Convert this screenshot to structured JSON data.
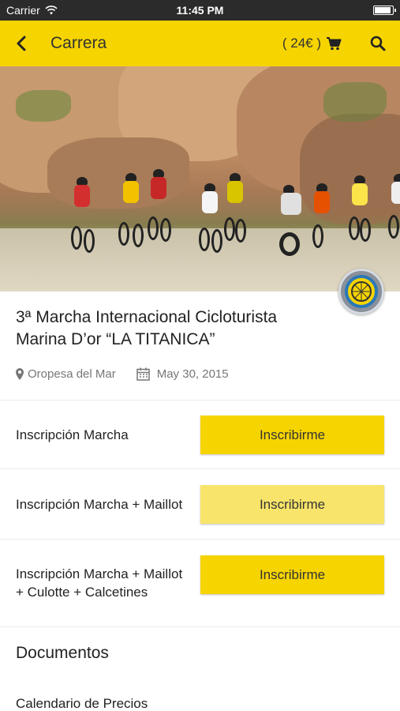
{
  "status_bar": {
    "carrier": "Carrier",
    "time": "11:45 PM"
  },
  "nav": {
    "title": "Carrera",
    "price": "( 24€ )"
  },
  "event": {
    "title": "3ª Marcha Internacional Cicloturista Marina D’or “LA TITANICA”",
    "location": "Oropesa del Mar",
    "date": "May 30, 2015"
  },
  "registrations": [
    {
      "label": "Inscripción Marcha",
      "button": "Inscribirme"
    },
    {
      "label": "Inscripción Marcha + Maillot",
      "button": "Inscribirme"
    },
    {
      "label": "Inscripción Marcha + Maillot + Culotte + Calcetines",
      "button": "Inscribirme"
    }
  ],
  "documents": {
    "title": "Documentos",
    "items": [
      "Calendario de Precios"
    ]
  },
  "colors": {
    "accent": "#f6d400",
    "accent_faded": "#f8e46a",
    "status_bar": "#2b2b2b"
  },
  "icons": [
    "back-icon",
    "cart-icon",
    "search-icon",
    "map-pin-icon",
    "calendar-icon",
    "wifi-icon",
    "battery-icon"
  ]
}
